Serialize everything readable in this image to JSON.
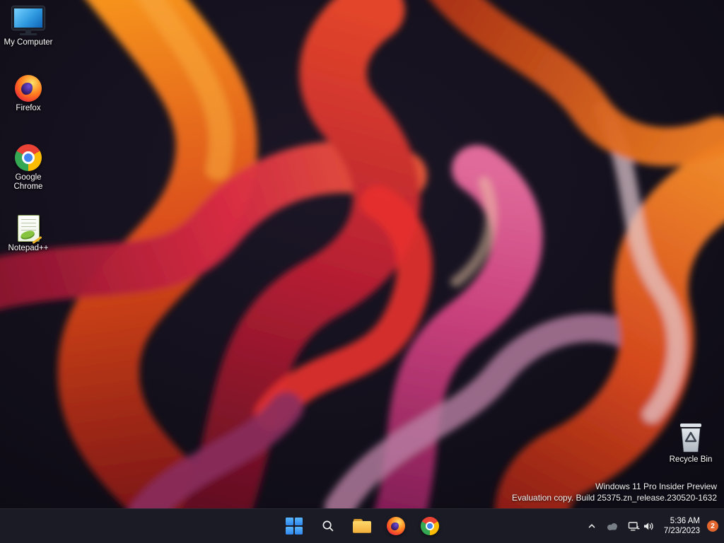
{
  "desktop": {
    "icons": [
      {
        "id": "my-computer",
        "label": "My Computer"
      },
      {
        "id": "firefox",
        "label": "Firefox"
      },
      {
        "id": "google-chrome",
        "label": "Google Chrome"
      },
      {
        "id": "notepad-plus-plus",
        "label": "Notepad++"
      },
      {
        "id": "recycle-bin",
        "label": "Recycle Bin"
      }
    ],
    "watermark": {
      "line1": "Windows 11 Pro Insider Preview",
      "line2": "Evaluation copy. Build 25375.zn_release.230520-1632"
    }
  },
  "taskbar": {
    "buttons": [
      {
        "id": "start",
        "icon": "windows-logo"
      },
      {
        "id": "search",
        "icon": "magnifier"
      },
      {
        "id": "file-explorer",
        "icon": "folder"
      },
      {
        "id": "firefox",
        "icon": "firefox-logo"
      },
      {
        "id": "chrome",
        "icon": "chrome-logo"
      }
    ],
    "tray": {
      "icons": [
        "chevron-up",
        "onedrive-cloud",
        "network",
        "volume"
      ],
      "time": "5:36 AM",
      "date": "7/23/2023",
      "notification_count": "2"
    }
  },
  "colors": {
    "taskbar_bg": "#1c1c26",
    "accent_blue": "#3d9bf0",
    "badge": "#e2662d",
    "wallpaper_base": "#0b0a12"
  }
}
